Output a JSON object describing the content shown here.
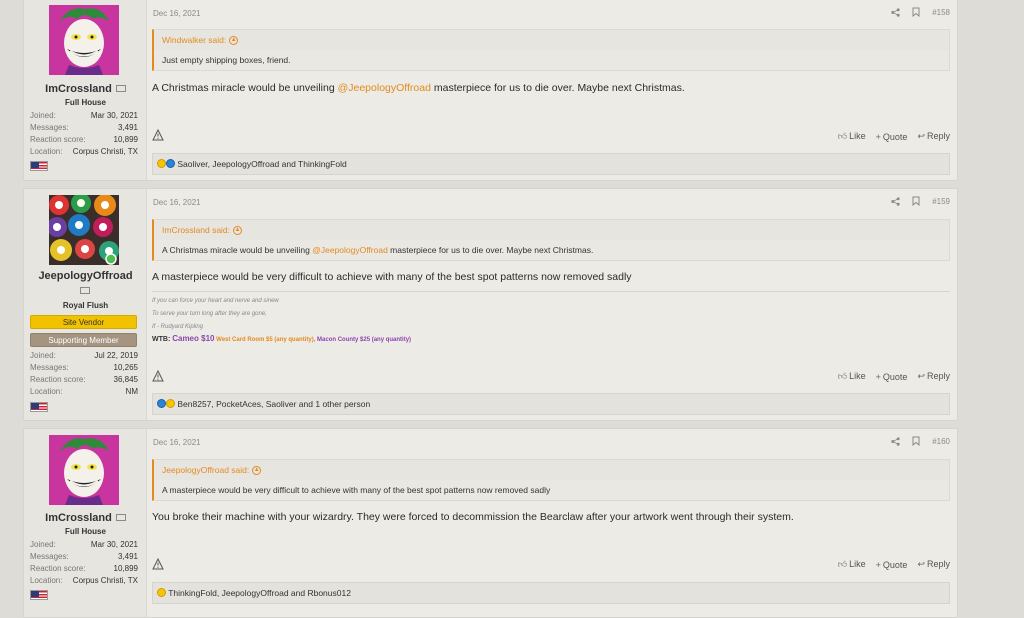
{
  "posts": [
    {
      "user": {
        "name": "ImCrossland",
        "title": "Full House",
        "joined_label": "Joined:",
        "joined": "Mar 30, 2021",
        "messages_label": "Messages:",
        "messages": "3,491",
        "reaction_label": "Reaction score:",
        "reaction": "10,899",
        "location_label": "Location:",
        "location": "Corpus Christi, TX"
      },
      "date": "Dec 16, 2021",
      "number": "#158",
      "quote_author": "Windwalker said:",
      "quote_text": "Just empty shipping boxes, friend.",
      "message_pre": "A Christmas miracle would be unveiling ",
      "message_mention": "@JeepologyOffroad",
      "message_post": " masterpiece for us to die over. Maybe next Christmas.",
      "actions": {
        "like": "Like",
        "quote": "Quote",
        "reply": "Reply"
      },
      "reactions_text": "Saoliver, JeepologyOffroad and ThinkingFold"
    },
    {
      "user": {
        "name": "JeepologyOffroad",
        "title": "Royal Flush",
        "badge1": "Site Vendor",
        "badge2": "Supporting Member",
        "joined_label": "Joined:",
        "joined": "Jul 22, 2019",
        "messages_label": "Messages:",
        "messages": "10,265",
        "reaction_label": "Reaction score:",
        "reaction": "36,845",
        "location_label": "Location:",
        "location": "NM"
      },
      "date": "Dec 16, 2021",
      "number": "#159",
      "quote_author": "ImCrossland said:",
      "quote_pre": "A Christmas miracle would be unveiling ",
      "quote_mention": "@JeepologyOffroad",
      "quote_post": " masterpiece for us to die over. Maybe next Christmas.",
      "message": "A masterpiece would be very difficult to achieve with many of the best spot patterns now removed sadly",
      "signature": {
        "line1": "If you can force your heart and nerve and sinew",
        "line2": "To serve your turn long after they are gone,",
        "line3": "If - Rudyard Kipling",
        "wtb_label": "WTB: ",
        "cameo": "Cameo $10",
        "west": " West Card Room $5 (any quantity), ",
        "macon": "Macon County $25 (any quantity)"
      },
      "actions": {
        "like": "Like",
        "quote": "Quote",
        "reply": "Reply"
      },
      "reactions_text": "Ben8257, PocketAces, Saoliver and 1 other person"
    },
    {
      "user": {
        "name": "ImCrossland",
        "title": "Full House",
        "joined_label": "Joined:",
        "joined": "Mar 30, 2021",
        "messages_label": "Messages:",
        "messages": "3,491",
        "reaction_label": "Reaction score:",
        "reaction": "10,899",
        "location_label": "Location:",
        "location": "Corpus Christi, TX"
      },
      "date": "Dec 16, 2021",
      "number": "#160",
      "quote_author": "JeepologyOffroad said:",
      "quote_text": "A masterpiece would be very difficult to achieve with many of the best spot patterns now removed sadly",
      "message": "You broke their machine with your wizardry. They were forced to decommission the Bearclaw after your artwork went through their system.",
      "actions": {
        "like": "Like",
        "quote": "Quote",
        "reply": "Reply"
      },
      "reactions_text": "ThinkingFold, JeepologyOffroad and Rbonus012"
    }
  ]
}
